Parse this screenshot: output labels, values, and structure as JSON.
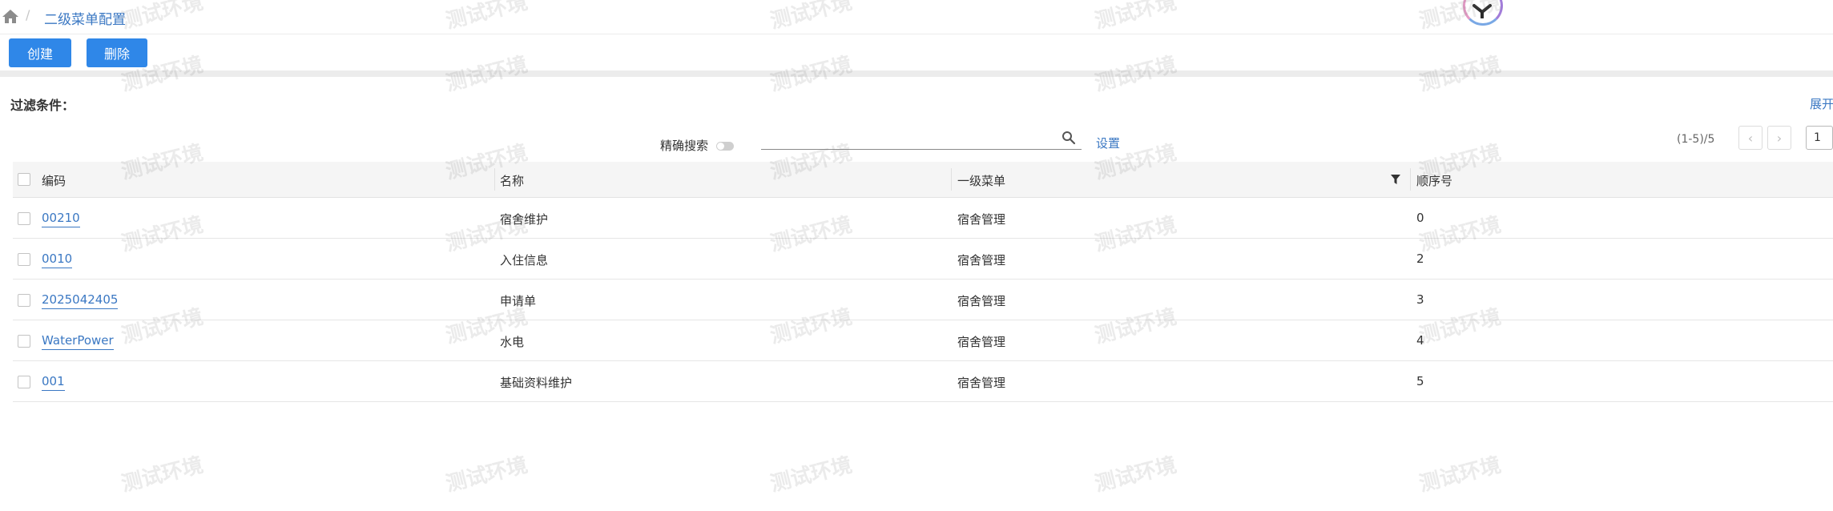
{
  "breadcrumb": {
    "current": "二级菜单配置"
  },
  "toolbar": {
    "create_label": "创建",
    "delete_label": "删除"
  },
  "filter": {
    "label": "过滤条件：",
    "expand_label": "展开"
  },
  "search": {
    "precise_label": "精确搜索",
    "precise_enabled": false,
    "value": "",
    "settings_label": "设置",
    "icon": "search-icon"
  },
  "pagination": {
    "range_text": "(1-5)/5",
    "current_page": "1"
  },
  "table": {
    "headers": {
      "code": "编码",
      "name": "名称",
      "parent_menu": "一级菜单",
      "order": "顺序号"
    },
    "rows": [
      {
        "code": "00210",
        "name": "宿舍维护",
        "parent_menu": "宿舍管理",
        "order": "0"
      },
      {
        "code": "0010",
        "name": "入住信息",
        "parent_menu": "宿舍管理",
        "order": "2"
      },
      {
        "code": "2025042405",
        "name": "申请单",
        "parent_menu": "宿舍管理",
        "order": "3"
      },
      {
        "code": "WaterPower",
        "name": "水电",
        "parent_menu": "宿舍管理",
        "order": "4"
      },
      {
        "code": "001",
        "name": "基础资料维护",
        "parent_menu": "宿舍管理",
        "order": "5"
      }
    ]
  },
  "watermark": {
    "text": "测试环境"
  },
  "colors": {
    "accent": "#2f87e8",
    "link": "#3b78c3"
  }
}
